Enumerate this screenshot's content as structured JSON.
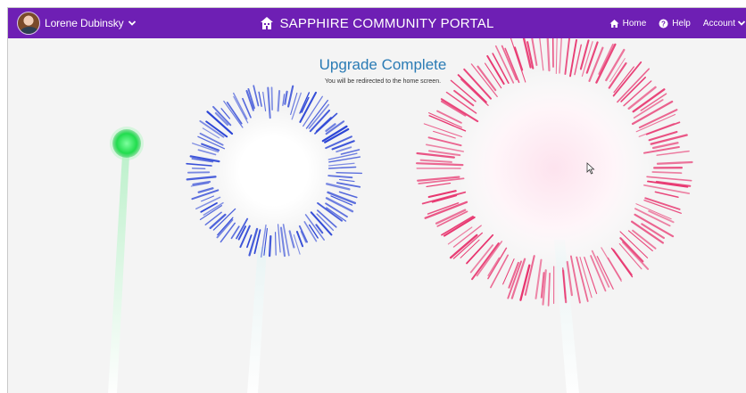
{
  "navbar": {
    "user_name": "Lorene Dubinsky",
    "portal_title": "SAPPHIRE COMMUNITY PORTAL",
    "links": [
      {
        "label": "Home",
        "icon": "home-icon"
      },
      {
        "label": "Help",
        "icon": "help-icon"
      },
      {
        "label": "Account",
        "icon": "chevron-down-icon"
      }
    ],
    "background_color": "#6e1fb4"
  },
  "main": {
    "headline": "Upgrade Complete",
    "subtitle": "You will be redirected to the home screen."
  },
  "fireworks": [
    {
      "name": "green-rocket",
      "color": "#22dd55"
    },
    {
      "name": "blue-burst",
      "color": "#2b44d6"
    },
    {
      "name": "pink-burst",
      "color": "#e8356f"
    }
  ]
}
